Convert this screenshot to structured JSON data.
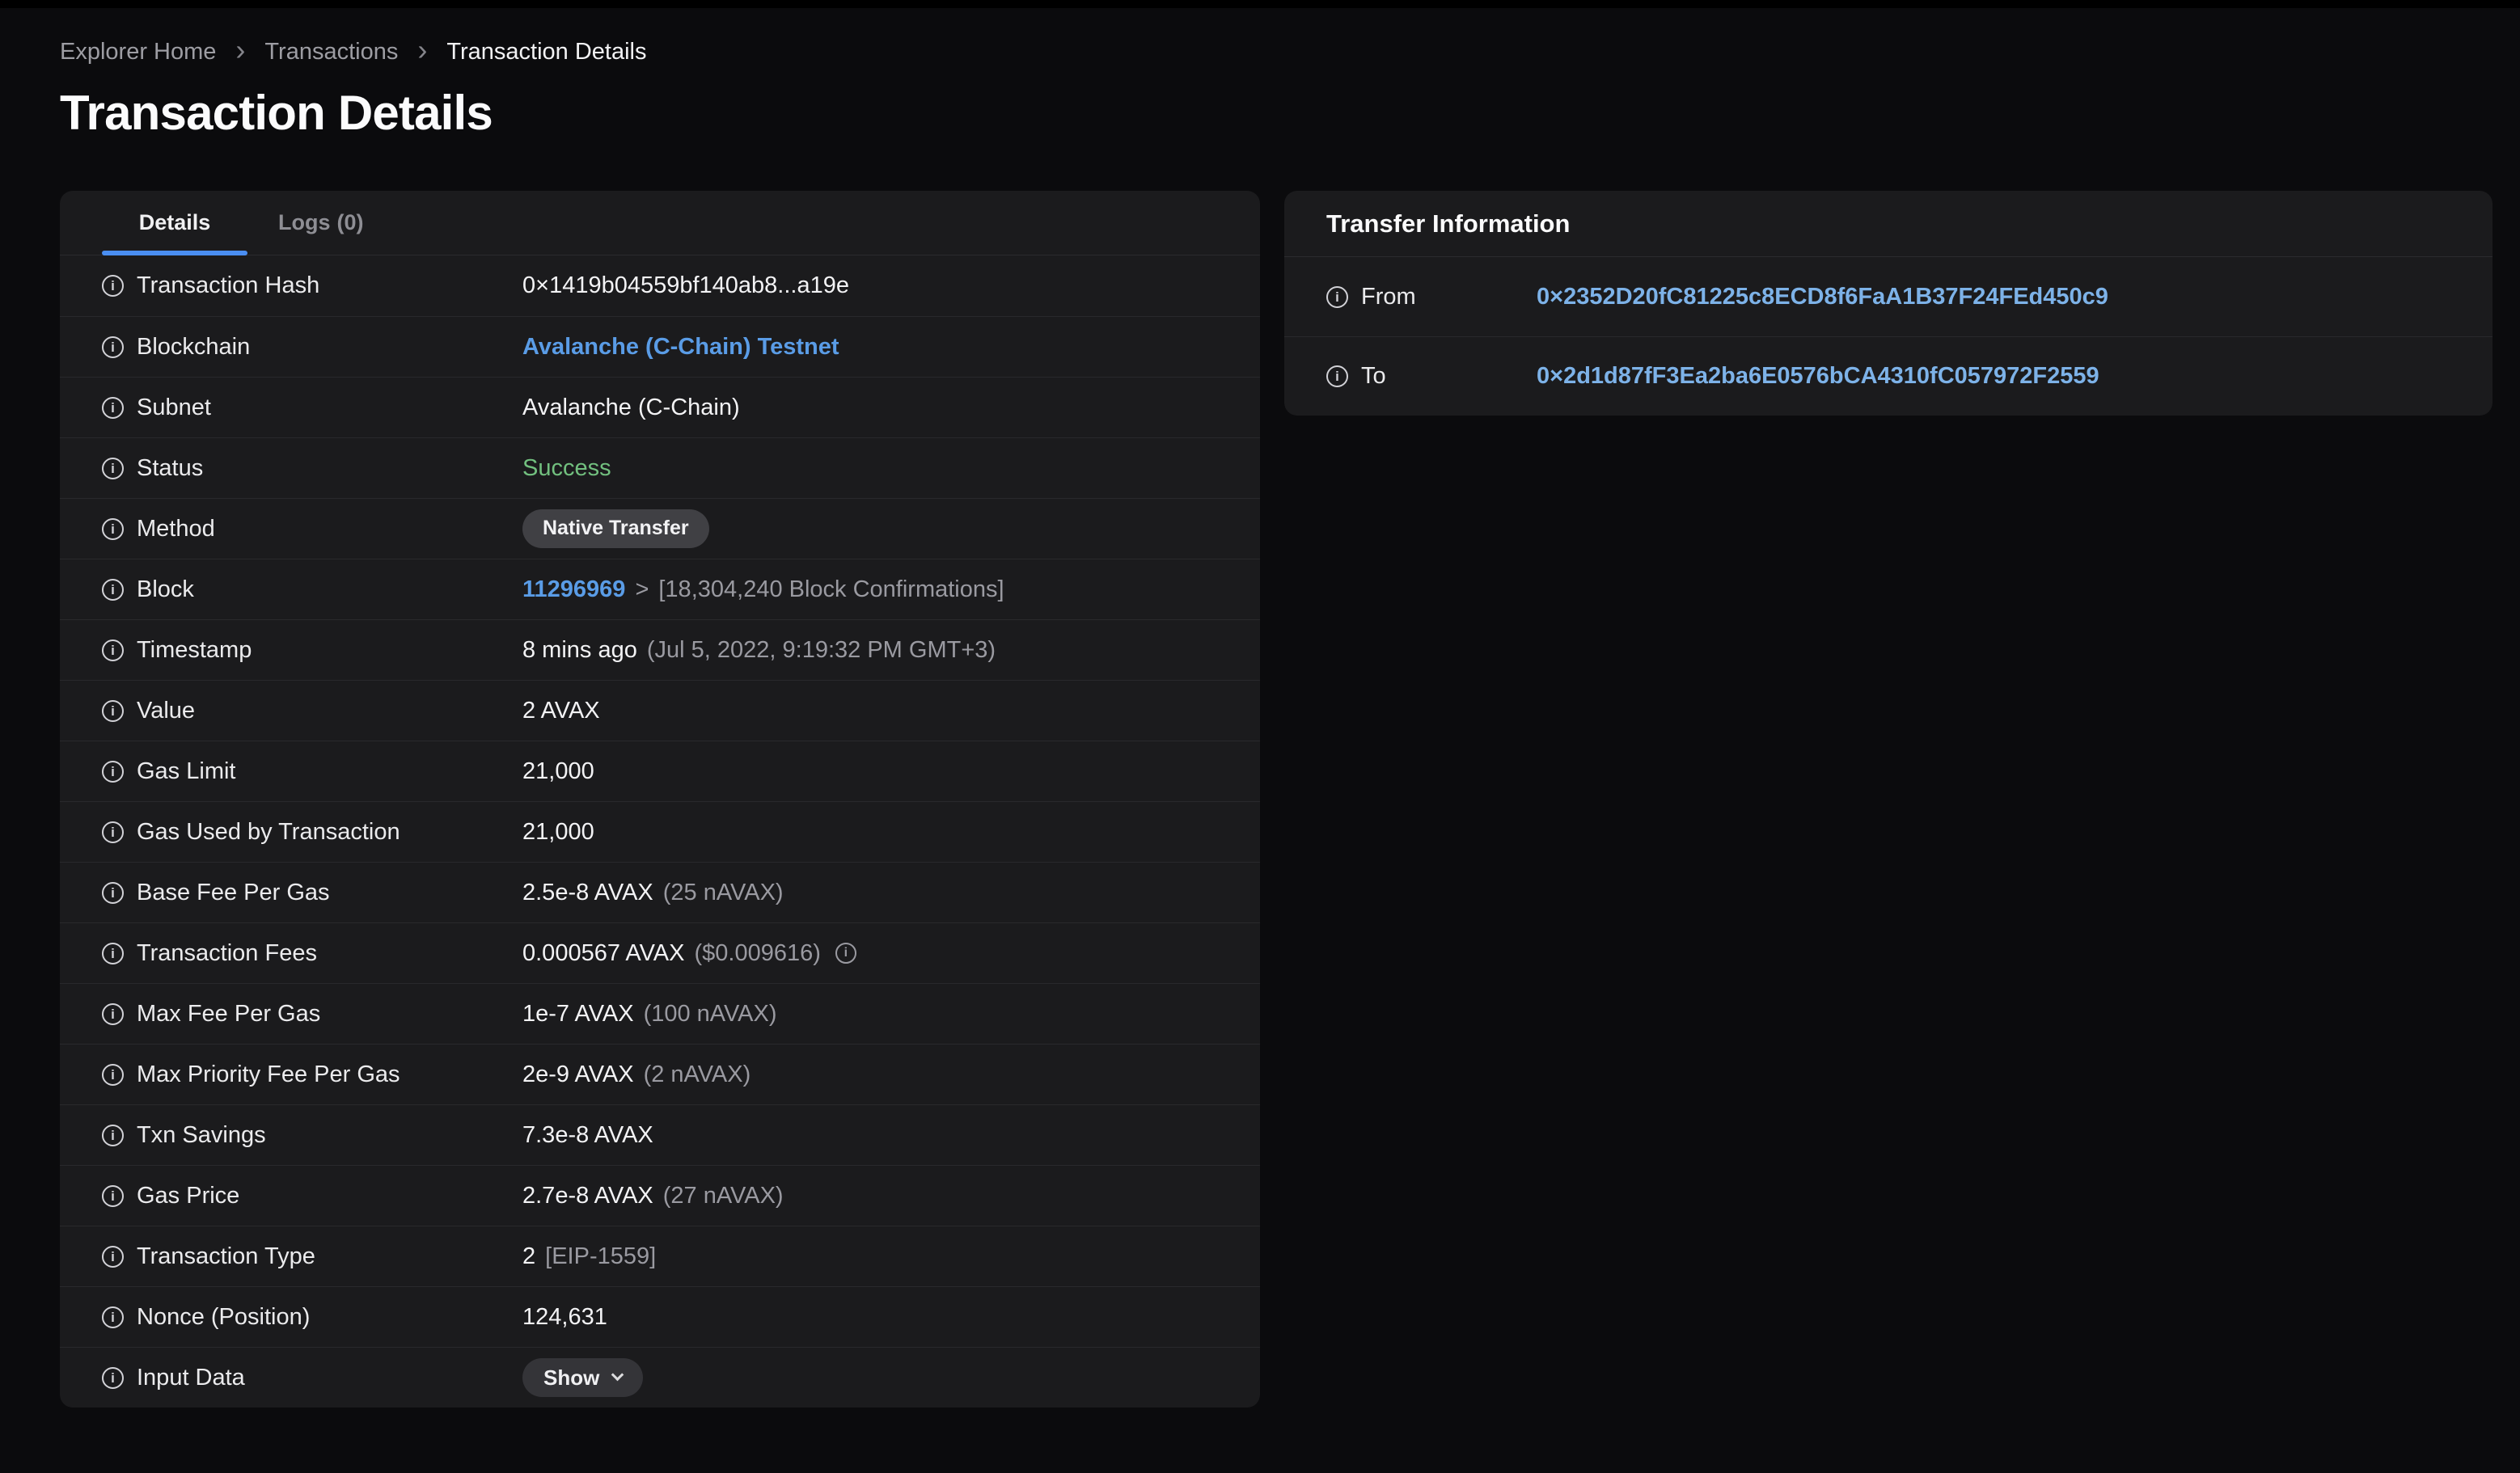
{
  "breadcrumb": {
    "items": [
      "Explorer Home",
      "Transactions",
      "Transaction Details"
    ]
  },
  "page_title": "Transaction Details",
  "colors": {
    "accent_blue": "#4a8ef2",
    "link_blue_bold": "#5a9ce6",
    "link_blue_address": "#7db2e8",
    "success_green": "#72c07f",
    "card_background": "#1b1b1d",
    "page_background": "#0b0b0d"
  },
  "details_card": {
    "tabs": [
      {
        "label": "Details",
        "active": true
      },
      {
        "label": "Logs",
        "count": "(0)",
        "active": false
      }
    ],
    "rows": [
      {
        "label": "Transaction Hash",
        "name": "row-transaction-hash",
        "parts": [
          {
            "t": "0×1419b04559bf140ab8...a19e",
            "s": "w",
            "n": "transaction-hash-value"
          }
        ]
      },
      {
        "label": "Blockchain",
        "name": "row-blockchain",
        "parts": [
          {
            "t": "Avalanche (C-Chain) Testnet",
            "s": "bb",
            "n": "blockchain-link",
            "i": true
          }
        ]
      },
      {
        "label": "Subnet",
        "name": "row-subnet",
        "parts": [
          {
            "t": "Avalanche (C-Chain)",
            "s": "w",
            "n": "subnet-value"
          }
        ]
      },
      {
        "label": "Status",
        "name": "row-status",
        "parts": [
          {
            "t": "Success",
            "s": "grn",
            "n": "status-value"
          }
        ]
      },
      {
        "label": "Method",
        "name": "row-method",
        "parts": [
          {
            "t": "Native Transfer",
            "s": "badge",
            "n": "method-badge"
          }
        ]
      },
      {
        "label": "Block",
        "name": "row-block",
        "parts": [
          {
            "t": "11296969",
            "s": "bb",
            "n": "block-link",
            "i": true
          },
          {
            "t": ">",
            "s": "g",
            "n": "block-separator"
          },
          {
            "t": "[18,304,240 Block Confirmations]",
            "s": "g",
            "n": "block-confirmations"
          }
        ]
      },
      {
        "label": "Timestamp",
        "name": "row-timestamp",
        "parts": [
          {
            "t": "8 mins ago",
            "s": "w",
            "n": "timestamp-relative"
          },
          {
            "t": "(Jul 5, 2022, 9:19:32 PM GMT+3)",
            "s": "g",
            "n": "timestamp-absolute"
          }
        ]
      },
      {
        "label": "Value",
        "name": "row-value-amount",
        "parts": [
          {
            "t": "2 AVAX",
            "s": "w",
            "n": "value-amount"
          }
        ]
      },
      {
        "label": "Gas Limit",
        "name": "row-gas-limit",
        "parts": [
          {
            "t": "21,000",
            "s": "w",
            "n": "gas-limit-value"
          }
        ]
      },
      {
        "label": "Gas Used by Transaction",
        "name": "row-gas-used",
        "parts": [
          {
            "t": "21,000",
            "s": "w",
            "n": "gas-used-value"
          }
        ]
      },
      {
        "label": "Base Fee Per Gas",
        "name": "row-base-fee-per-gas",
        "parts": [
          {
            "t": "2.5e-8 AVAX",
            "s": "w",
            "n": "base-fee-value"
          },
          {
            "t": "(25 nAVAX)",
            "s": "g",
            "n": "base-fee-navax"
          }
        ]
      },
      {
        "label": "Transaction Fees",
        "name": "row-transaction-fees",
        "parts": [
          {
            "t": "0.000567 AVAX",
            "s": "w",
            "n": "fees-value"
          },
          {
            "t": "($0.009616)",
            "s": "g",
            "n": "fees-usd"
          },
          {
            "s": "info",
            "n": "fees-info-icon",
            "i": true
          }
        ]
      },
      {
        "label": "Max Fee Per Gas",
        "name": "row-max-fee-per-gas",
        "parts": [
          {
            "t": "1e-7 AVAX",
            "s": "w",
            "n": "max-fee-value"
          },
          {
            "t": "(100 nAVAX)",
            "s": "g",
            "n": "max-fee-navax"
          }
        ]
      },
      {
        "label": "Max Priority Fee Per Gas",
        "name": "row-max-priority-fee-per-gas",
        "parts": [
          {
            "t": "2e-9 AVAX",
            "s": "w",
            "n": "max-priority-fee-value"
          },
          {
            "t": "(2 nAVAX)",
            "s": "g",
            "n": "max-priority-fee-navax"
          }
        ]
      },
      {
        "label": "Txn Savings",
        "name": "row-txn-savings",
        "parts": [
          {
            "t": "7.3e-8 AVAX",
            "s": "w",
            "n": "txn-savings-value"
          }
        ]
      },
      {
        "label": "Gas Price",
        "name": "row-gas-price",
        "parts": [
          {
            "t": "2.7e-8 AVAX",
            "s": "w",
            "n": "gas-price-value"
          },
          {
            "t": "(27 nAVAX)",
            "s": "g",
            "n": "gas-price-navax"
          }
        ]
      },
      {
        "label": "Transaction Type",
        "name": "row-transaction-type",
        "parts": [
          {
            "t": "2",
            "s": "w",
            "n": "transaction-type-value"
          },
          {
            "t": "[EIP-1559]",
            "s": "g",
            "n": "transaction-type-eip"
          }
        ]
      },
      {
        "label": "Nonce (Position)",
        "name": "row-nonce",
        "parts": [
          {
            "t": "124,631",
            "s": "w",
            "n": "nonce-value"
          }
        ]
      },
      {
        "label": "Input Data",
        "name": "row-input-data",
        "parts": [
          {
            "t": "Show",
            "s": "btn",
            "n": "show-button",
            "i": true
          }
        ]
      }
    ]
  },
  "transfer_card": {
    "title": "Transfer Information",
    "rows": [
      {
        "label": "From",
        "name": "row-from",
        "parts": [
          {
            "t": "0×2352D20fC81225c8ECD8f6FaA1B37F24FEd450c9",
            "s": "bl",
            "n": "from-address-link",
            "i": true
          }
        ]
      },
      {
        "label": "To",
        "name": "row-to",
        "parts": [
          {
            "t": "0×2d1d87fF3Ea2ba6E0576bCA4310fC057972F2559",
            "s": "bl",
            "n": "to-address-link",
            "i": true
          }
        ]
      }
    ]
  }
}
